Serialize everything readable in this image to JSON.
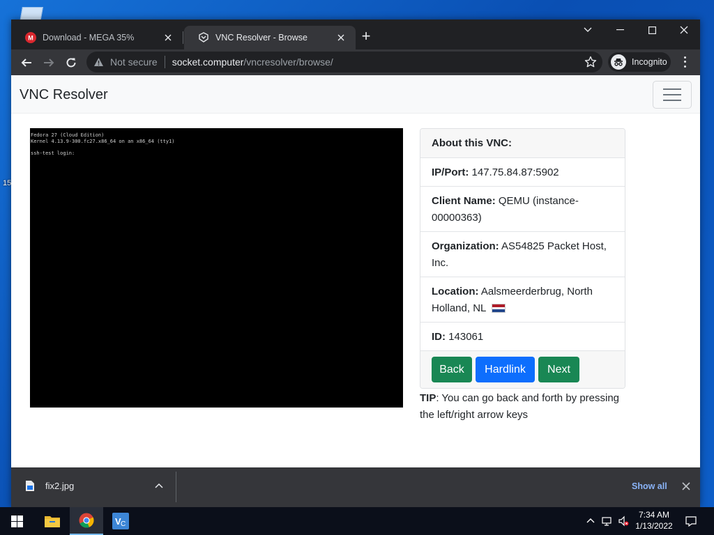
{
  "desktop": {
    "fragment_text": "15"
  },
  "browser": {
    "tabs": [
      {
        "title": "Download - MEGA 35%",
        "favicon": "mega-icon"
      },
      {
        "title": "VNC Resolver - Browse",
        "favicon": "vnc-resolver-icon"
      }
    ],
    "active_tab_index": 1,
    "address": {
      "security_label": "Not secure",
      "host": "socket.computer",
      "path": "/vncresolver/browse/"
    },
    "profile_label": "Incognito"
  },
  "page": {
    "brand": "VNC Resolver",
    "vnc_console_lines": [
      "Fedora 27 (Cloud Edition)",
      "Kernel 4.13.9-300.fc27.x86_64 on an x86_64 (tty1)",
      "",
      "ssh-test login:"
    ],
    "card": {
      "header": "About this VNC:",
      "ip_port_label": "IP/Port:",
      "ip_port_value": "147.75.84.87:5902",
      "client_label": "Client Name:",
      "client_value": "QEMU (instance-00000363)",
      "org_label": "Organization:",
      "org_value": "AS54825 Packet Host, Inc.",
      "location_label": "Location:",
      "location_value": "Aalsmeerderbrug, North Holland, NL",
      "location_flag": "netherlands-flag",
      "id_label": "ID:",
      "id_value": "143061"
    },
    "buttons": {
      "back": "Back",
      "hardlink": "Hardlink",
      "next": "Next"
    },
    "tip": {
      "label": "TIP",
      "text": ": You can go back and forth by pressing the left/right arrow keys"
    }
  },
  "downloads": {
    "file_name": "fix2.jpg",
    "show_all": "Show all"
  },
  "taskbar": {
    "time": "7:34 AM",
    "date": "1/13/2022"
  }
}
